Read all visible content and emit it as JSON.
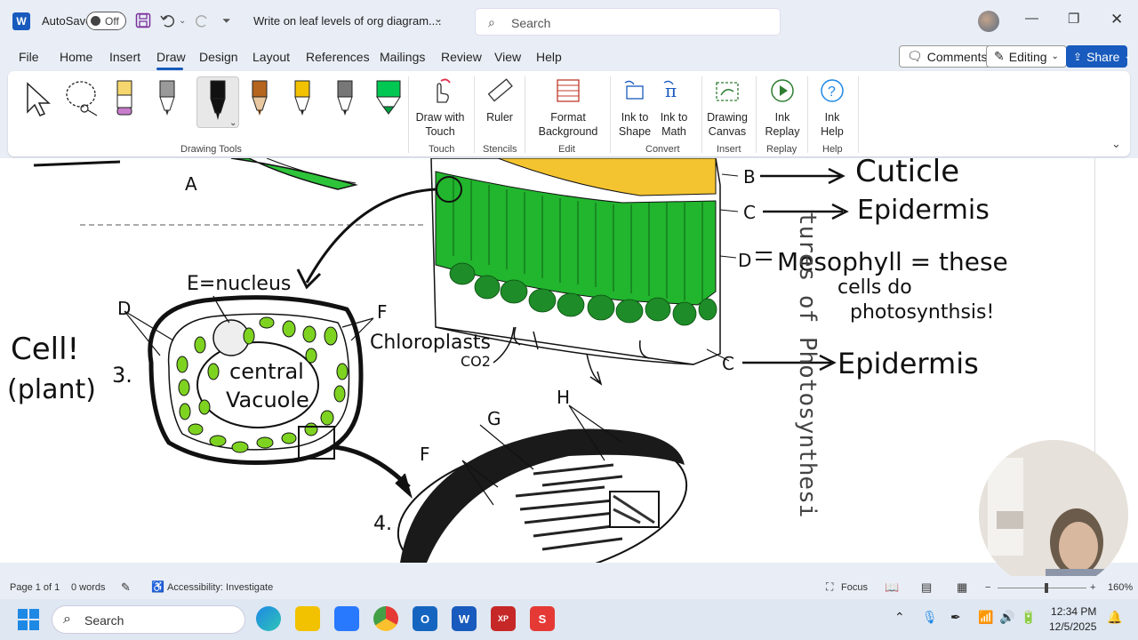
{
  "titlebar": {
    "autosave_label": "AutoSave",
    "autosave_state": "Off",
    "doc_title": "Write on leaf levels of org diagram....",
    "search_placeholder": "Search"
  },
  "menu": {
    "tabs": [
      "File",
      "Home",
      "Insert",
      "Draw",
      "Design",
      "Layout",
      "References",
      "Mailings",
      "Review",
      "View",
      "Help"
    ],
    "active_tab": "Draw",
    "comments_label": "Comments",
    "editing_label": "Editing",
    "share_label": "Share"
  },
  "ribbon": {
    "groups": {
      "drawing_tools": "Drawing Tools",
      "touch": "Touch",
      "stencils": "Stencils",
      "edit": "Edit",
      "convert": "Convert",
      "insert": "Insert",
      "replay": "Replay",
      "help": "Help"
    },
    "buttons": {
      "draw_with_touch_1": "Draw with",
      "draw_with_touch_2": "Touch",
      "ruler": "Ruler",
      "format_bg_1": "Format",
      "format_bg_2": "Background",
      "ink_to_shape_1": "Ink to",
      "ink_to_shape_2": "Shape",
      "ink_to_math_1": "Ink to",
      "ink_to_math_2": "Math",
      "drawing_canvas_1": "Drawing",
      "drawing_canvas_2": "Canvas",
      "ink_replay_1": "Ink",
      "ink_replay_2": "Replay",
      "ink_help_1": "Ink",
      "ink_help_2": "Help"
    },
    "pens": [
      {
        "name": "highlighter-yellow",
        "color": "#f5d76e"
      },
      {
        "name": "pencil-gray",
        "color": "#9a9a9a"
      },
      {
        "name": "pen-black",
        "color": "#111111"
      },
      {
        "name": "pencil-brown",
        "color": "#b5651d"
      },
      {
        "name": "pen-yellow",
        "color": "#f2c200"
      },
      {
        "name": "pen-gray",
        "color": "#777777"
      },
      {
        "name": "highlighter-green",
        "color": "#00c853"
      }
    ]
  },
  "document": {
    "labels": {
      "A": "A",
      "B": "B",
      "C1": "C",
      "C2": "C",
      "D1": "D",
      "D2": "D",
      "E_nucleus": "E=nucleus",
      "F1": "F",
      "F2": "F",
      "G": "G",
      "H": "H",
      "num3": "3.",
      "num4": "4."
    },
    "handwriting": {
      "cuticle": "Cuticle",
      "epidermis_top": "Epidermis",
      "mesophyll_1": "Mesophyll = these",
      "mesophyll_2": "cells do",
      "mesophyll_3": "photosynthsis!",
      "epidermis_bottom": "Epidermis",
      "cell_1": "Cell!",
      "cell_2": "(plant)",
      "chloroplasts": "Chloroplasts",
      "co2": "CO2",
      "central": "central",
      "vacuole": "Vacuole"
    },
    "vertical_text": "tures of Photosynthesi"
  },
  "status": {
    "page": "Page 1 of 1",
    "words": "0 words",
    "accessibility": "Accessibility: Investigate",
    "focus": "Focus",
    "zoom": "160%"
  },
  "taskbar": {
    "search_placeholder": "Search",
    "time": "12:34 PM",
    "date": "12/5/2025"
  }
}
